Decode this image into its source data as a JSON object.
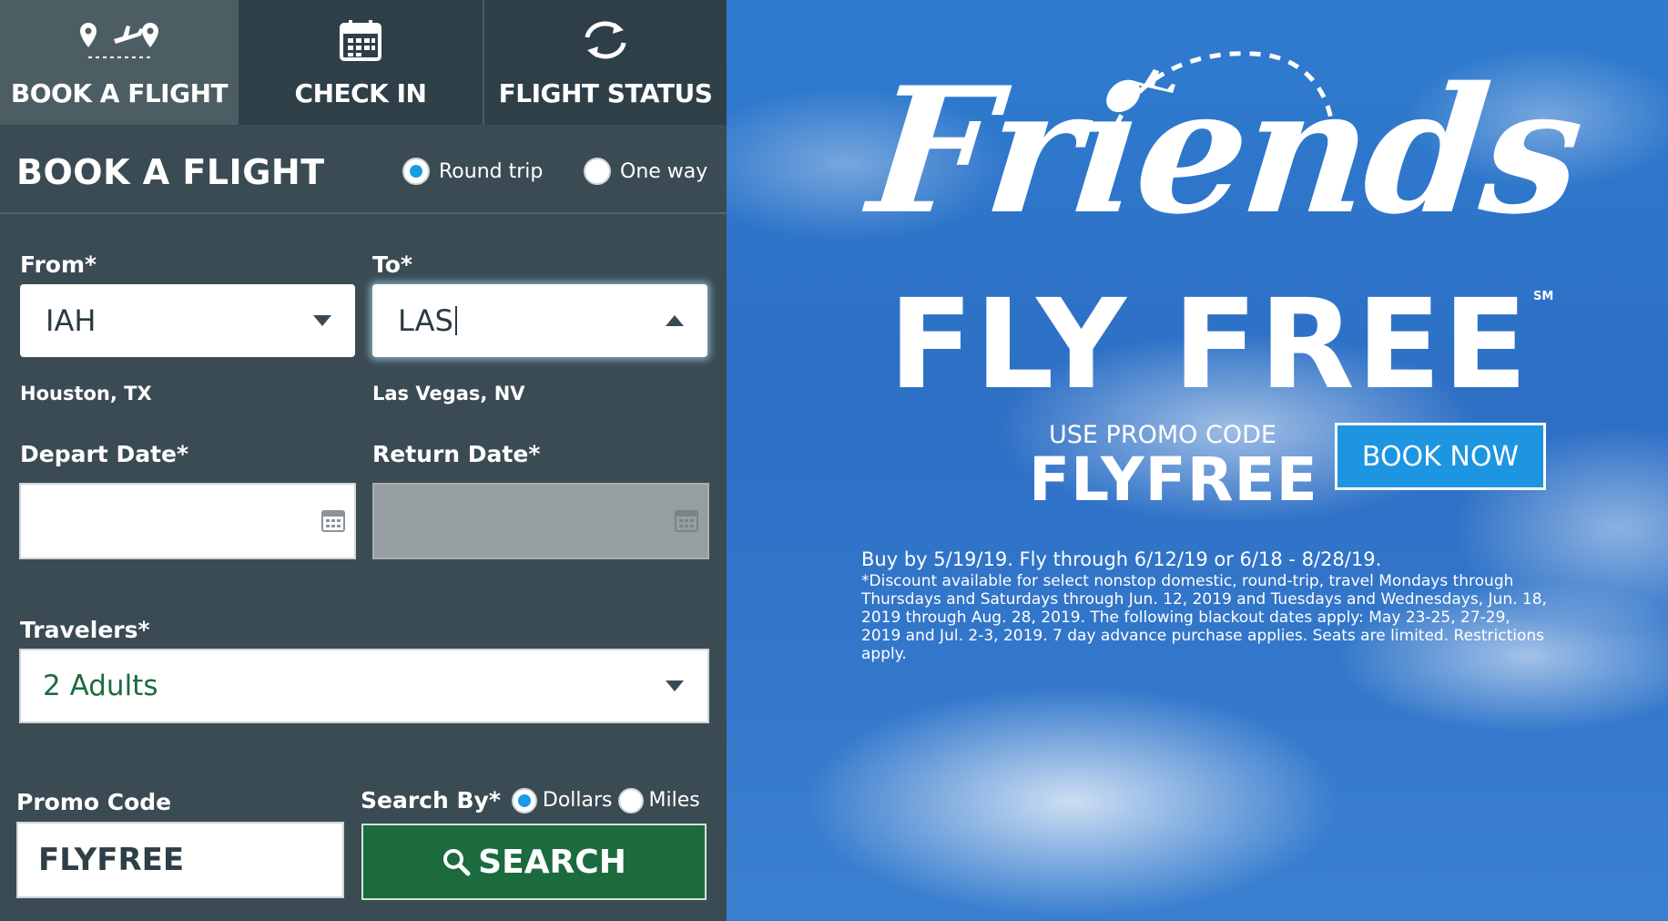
{
  "tabs": [
    {
      "label": "BOOK A FLIGHT",
      "icon": "route-plane-icon"
    },
    {
      "label": "CHECK IN",
      "icon": "calendar-icon"
    },
    {
      "label": "FLIGHT STATUS",
      "icon": "refresh-icon"
    }
  ],
  "booking": {
    "title": "BOOK A FLIGHT",
    "trip_types": [
      "Round trip",
      "One way"
    ],
    "selected_trip": "Round trip",
    "from_label": "From*",
    "from_value": "IAH",
    "from_city": "Houston, TX",
    "to_label": "To*",
    "to_value": "LAS",
    "to_city": "Las Vegas, NV",
    "depart_label": "Depart Date*",
    "return_label": "Return Date*",
    "travelers_label": "Travelers*",
    "travelers_value": "2 Adults",
    "promo_label": "Promo Code",
    "promo_value": "FLYFREE",
    "search_by_label": "Search By*",
    "search_by_options": [
      "Dollars",
      "Miles"
    ],
    "search_by_selected": "Dollars",
    "search_button": "SEARCH"
  },
  "banner": {
    "headline_script": "Friends",
    "headline_bold": "FLY FREE",
    "service_mark": "SM",
    "use_promo": "USE PROMO CODE",
    "promo_code": "FLYFREE",
    "book_now": "BOOK NOW",
    "fine_print_1": "Buy by 5/19/19. Fly through 6/12/19 or 6/18 - 8/28/19.",
    "fine_print_2": "*Discount available for select nonstop domestic, round-trip, travel Mondays through Thursdays and Saturdays through Jun. 12, 2019 and Tuesdays and Wednesdays, Jun. 18, 2019 through Aug. 28, 2019. The following blackout dates apply: May 23-25, 27-29, 2019 and Jul. 2-3, 2019. 7 day advance purchase applies. Seats are limited. Restrictions apply."
  },
  "colors": {
    "panel_bg": "#3b4b53",
    "tab_bg": "#2f3f47",
    "active_tab_bg": "#4d5d64",
    "search_green": "#1c6b3e",
    "radio_blue": "#1a9be6",
    "banner_blue": "#2d6fc5",
    "book_now_blue": "#1e95e0"
  }
}
